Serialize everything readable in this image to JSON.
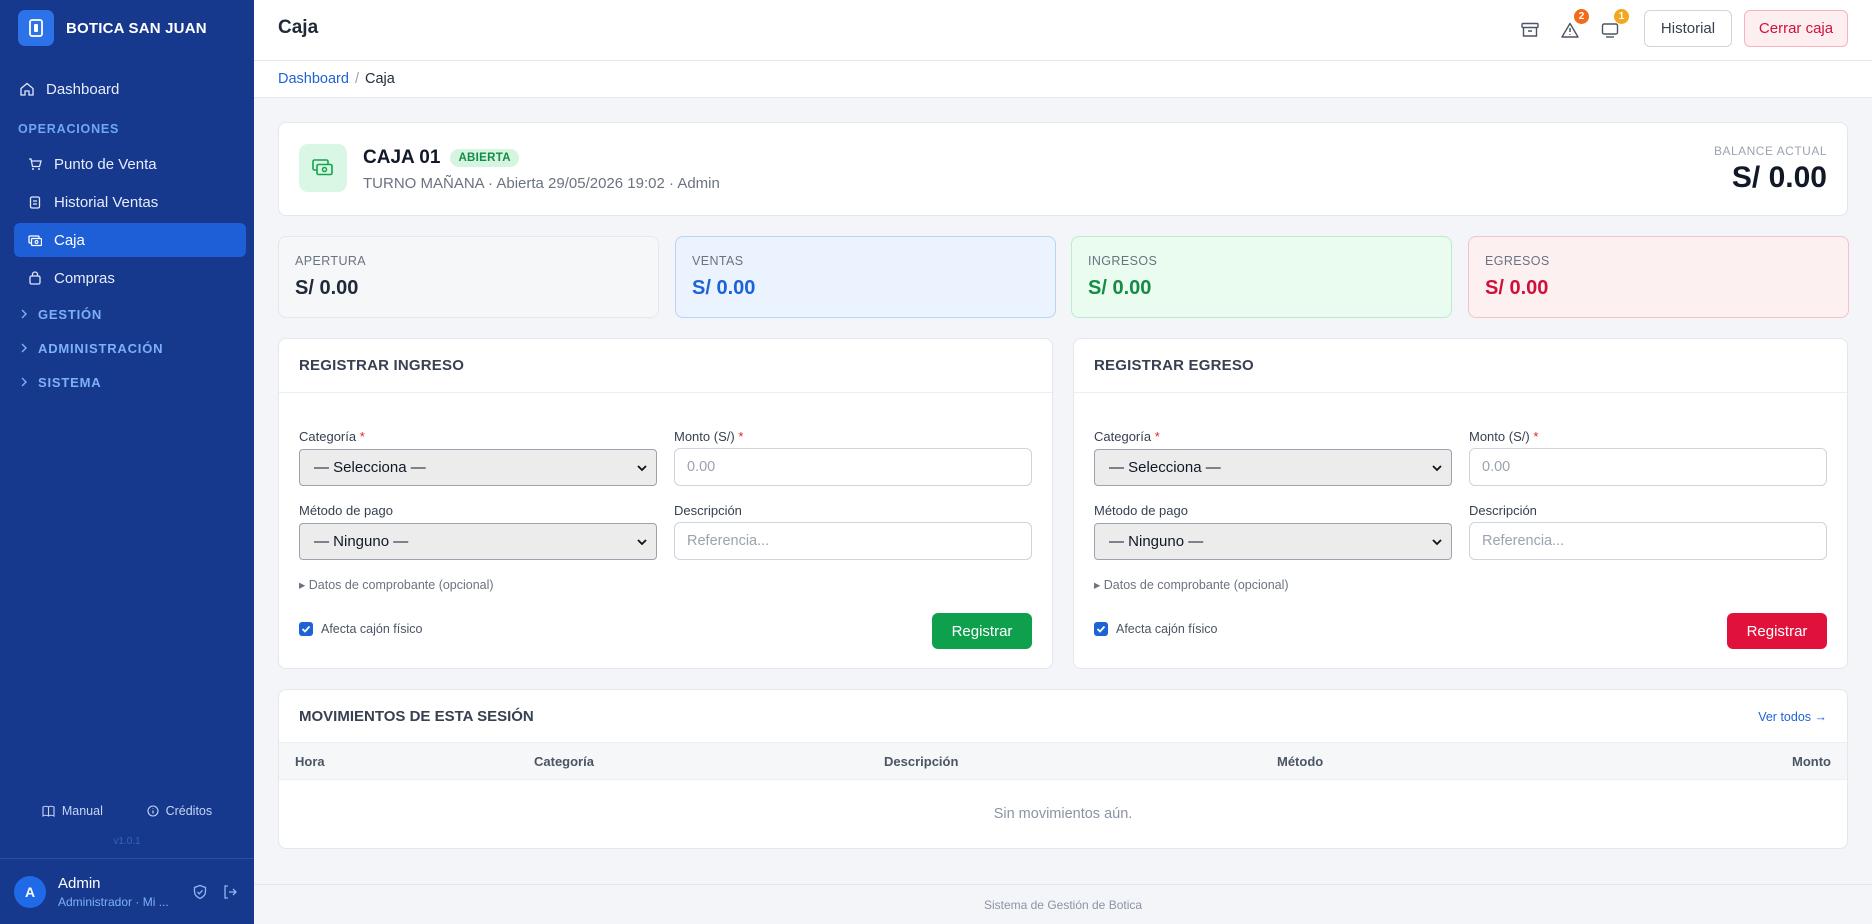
{
  "sidebar": {
    "brand": "BOTICA SAN JUAN",
    "dashboard": "Dashboard",
    "section_operaciones": "OPERACIONES",
    "items": [
      {
        "label": "Punto de Venta"
      },
      {
        "label": "Historial Ventas"
      },
      {
        "label": "Caja"
      },
      {
        "label": "Compras"
      }
    ],
    "groups": [
      {
        "label": "GESTIÓN"
      },
      {
        "label": "ADMINISTRACIÓN"
      },
      {
        "label": "SISTEMA"
      }
    ],
    "manual": "Manual",
    "creditos": "Créditos",
    "version": "v1.0.1",
    "user": {
      "initial": "A",
      "name": "Admin",
      "role": "Administrador · Mi ..."
    }
  },
  "topbar": {
    "title": "Caja",
    "alerts_count": "2",
    "messages_count": "1",
    "historial": "Historial",
    "cerrar_caja": "Cerrar caja"
  },
  "breadcrumb": {
    "home": "Dashboard",
    "sep": "/",
    "current": "Caja"
  },
  "caja": {
    "name": "CAJA 01",
    "status": "ABIERTA",
    "subtitle": "TURNO MAÑANA · Abierta 29/05/2026 19:02 · Admin",
    "balance_label": "BALANCE ACTUAL",
    "balance": "S/ 0.00"
  },
  "stats": [
    {
      "label": "APERTURA",
      "value": "S/ 0.00"
    },
    {
      "label": "VENTAS",
      "value": "S/ 0.00"
    },
    {
      "label": "INGRESOS",
      "value": "S/ 0.00"
    },
    {
      "label": "EGRESOS",
      "value": "S/ 0.00"
    }
  ],
  "ingreso": {
    "title": "REGISTRAR INGRESO",
    "categoria_label": "Categoría",
    "categoria_value": "— Selecciona —",
    "monto_label": "Monto (S/)",
    "monto_placeholder": "0.00",
    "metodo_label": "Método de pago",
    "metodo_value": "— Ninguno —",
    "descripcion_label": "Descripción",
    "descripcion_placeholder": "Referencia...",
    "comprobante": "Datos de comprobante (opcional)",
    "afecta": "Afecta cajón físico",
    "submit": "Registrar"
  },
  "egreso": {
    "title": "REGISTRAR EGRESO",
    "categoria_label": "Categoría",
    "categoria_value": "— Selecciona —",
    "monto_label": "Monto (S/)",
    "monto_placeholder": "0.00",
    "metodo_label": "Método de pago",
    "metodo_value": "— Ninguno —",
    "descripcion_label": "Descripción",
    "descripcion_placeholder": "Referencia...",
    "comprobante": "Datos de comprobante (opcional)",
    "afecta": "Afecta cajón físico",
    "submit": "Registrar"
  },
  "movimientos": {
    "title": "MOVIMIENTOS DE ESTA SESIÓN",
    "ver_todos": "Ver todos →",
    "columns": [
      "Hora",
      "Categoría",
      "Descripción",
      "Método",
      "Monto"
    ],
    "empty": "Sin movimientos aún."
  },
  "footer": "Sistema de Gestión de Botica",
  "colors": {
    "sidebar": "#17398d",
    "active": "#1e5fd8",
    "success": "#0fa04d",
    "danger": "#e0123b"
  }
}
